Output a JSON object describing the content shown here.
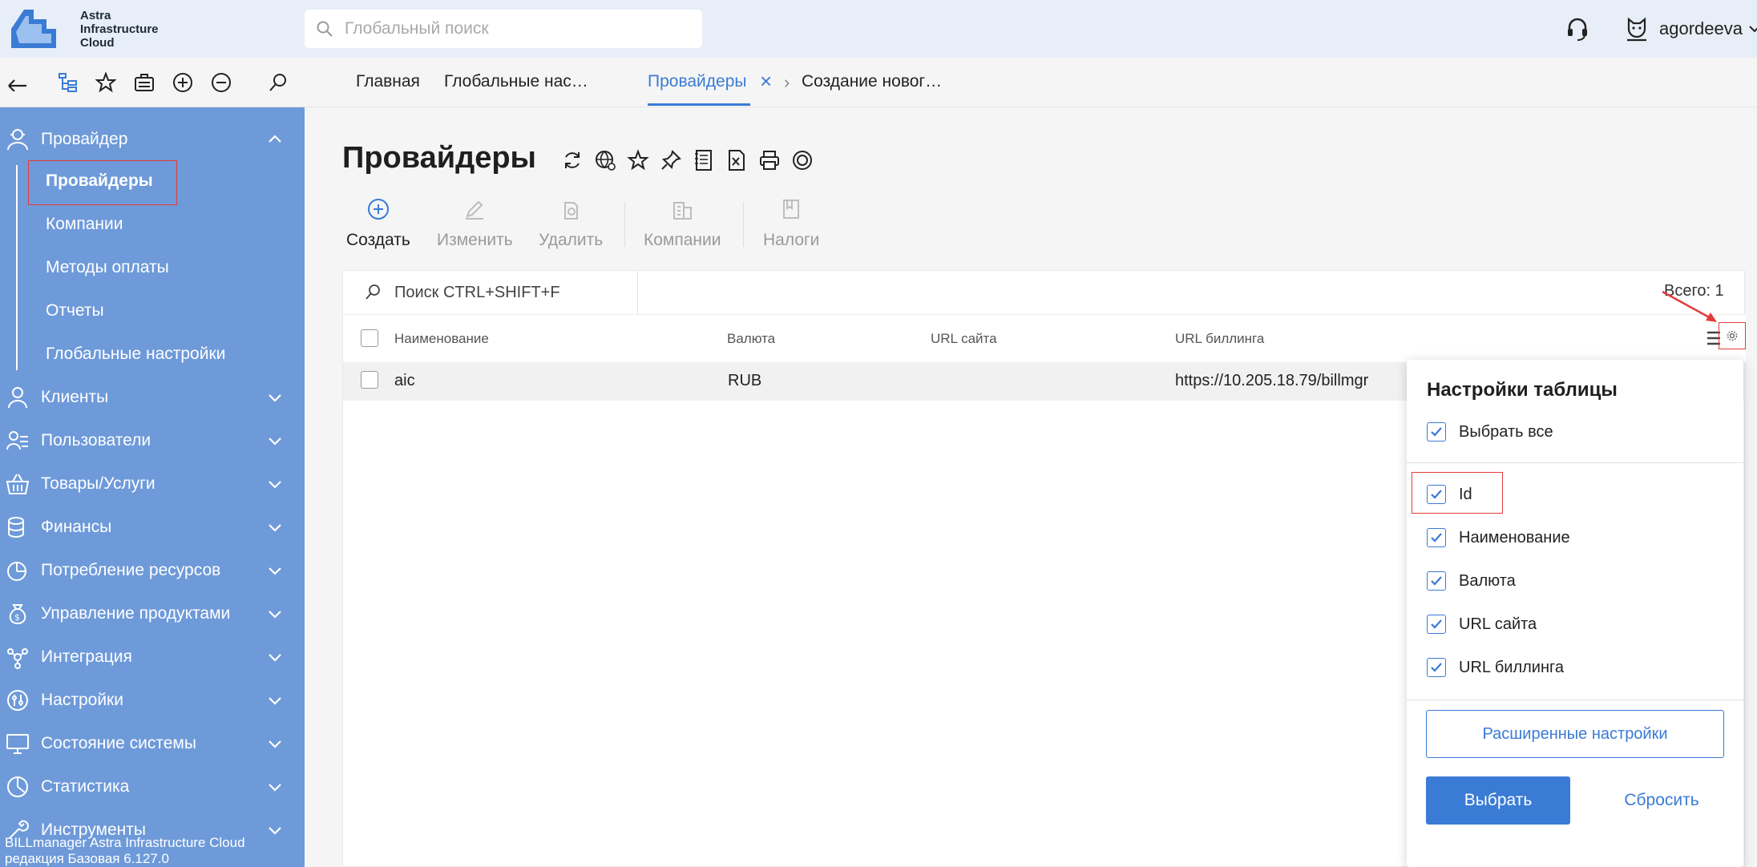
{
  "app": {
    "logo_text": [
      "Astra",
      "Infrastructure",
      "Cloud"
    ],
    "global_search_placeholder": "Глобальный поиск",
    "user_name": "agordeeva"
  },
  "breadcrumbs": [
    {
      "label": "Главная"
    },
    {
      "label": "Глобальные нас…"
    },
    {
      "label": "Провайдеры",
      "active": true
    },
    {
      "label": "Создание новог…"
    }
  ],
  "sidebar": {
    "sections": [
      {
        "label": "Провайдер",
        "icon": "provider-icon",
        "expanded": true
      },
      {
        "label": "Клиенты",
        "icon": "clients-icon"
      },
      {
        "label": "Пользователи",
        "icon": "users-icon"
      },
      {
        "label": "Товары/Услуги",
        "icon": "basket-icon"
      },
      {
        "label": "Финансы",
        "icon": "finance-icon"
      },
      {
        "label": "Потребление ресурсов",
        "icon": "pie-chart-icon"
      },
      {
        "label": "Управление продуктами",
        "icon": "money-bag-icon"
      },
      {
        "label": "Интеграция",
        "icon": "integration-icon"
      },
      {
        "label": "Настройки",
        "icon": "settings-sliders-icon"
      },
      {
        "label": "Состояние системы",
        "icon": "monitor-icon"
      },
      {
        "label": "Статистика",
        "icon": "statistics-icon"
      },
      {
        "label": "Инструменты",
        "icon": "tools-icon"
      }
    ],
    "provider_items": [
      "Провайдеры",
      "Компании",
      "Методы оплаты",
      "Отчеты",
      "Глобальные настройки"
    ],
    "footer": [
      "BILLmanager Astra Infrastructure Cloud",
      "редакция Базовая 6.127.0"
    ]
  },
  "page": {
    "title": "Провайдеры",
    "actions": [
      {
        "label": "Создать",
        "icon": "plus-circle-icon",
        "enabled": true
      },
      {
        "label": "Изменить",
        "icon": "edit-icon",
        "enabled": false
      },
      {
        "label": "Удалить",
        "icon": "delete-icon",
        "enabled": false
      },
      {
        "label": "Компании",
        "icon": "building-icon",
        "enabled": false
      },
      {
        "label": "Налоги",
        "icon": "document-icon",
        "enabled": false
      }
    ]
  },
  "table": {
    "search_placeholder": "Поиск CTRL+SHIFT+F",
    "total": "Всего: 1",
    "columns": [
      "Наименование",
      "Валюта",
      "URL сайта",
      "URL биллинга"
    ],
    "rows": [
      {
        "name": "aic",
        "currency": "RUB",
        "site_url": "",
        "billing_url": "https://10.205.18.79/billmgr"
      }
    ]
  },
  "table_settings": {
    "title": "Настройки таблицы",
    "select_all": "Выбрать все",
    "columns": [
      "Id",
      "Наименование",
      "Валюта",
      "URL сайта",
      "URL биллинга"
    ],
    "advanced_button": "Расширенные настройки",
    "apply_button": "Выбрать",
    "reset_button": "Сбросить"
  },
  "colors": {
    "accent": "#3a7bd5",
    "sidebar": "#6e9ad9",
    "highlight": "#e23b3b"
  }
}
